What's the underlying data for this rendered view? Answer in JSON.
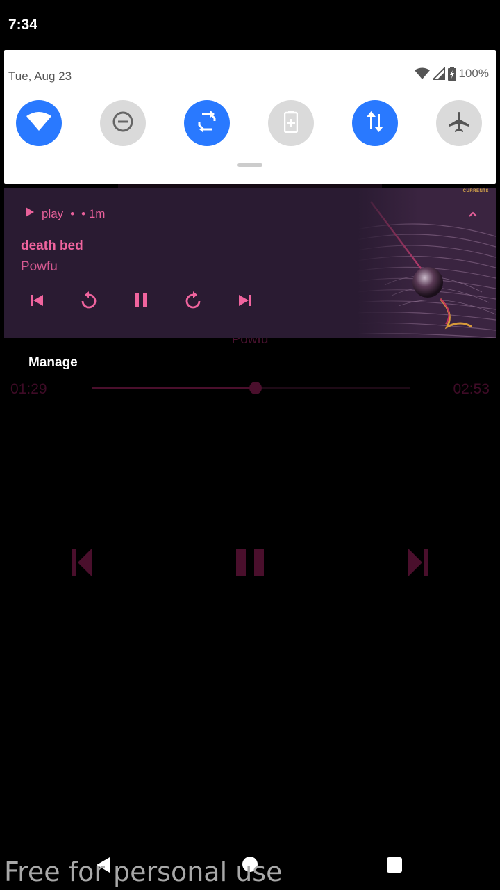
{
  "status_bar": {
    "time": "7:34"
  },
  "background_player": {
    "artist": "Powfu",
    "elapsed": "01:29",
    "duration": "02:53",
    "progress": 0.515
  },
  "quick_settings": {
    "date": "Tue, Aug 23",
    "battery": "100%",
    "tiles": [
      {
        "name": "wifi",
        "state": "on",
        "icon": "wifi-icon"
      },
      {
        "name": "do-not-disturb",
        "state": "off",
        "icon": "minus-circle-icon"
      },
      {
        "name": "auto-rotate",
        "state": "on",
        "icon": "rotate-icon"
      },
      {
        "name": "battery-saver",
        "state": "off",
        "icon": "battery-icon"
      },
      {
        "name": "mobile-data",
        "state": "on",
        "icon": "data-arrows-icon"
      },
      {
        "name": "airplane-mode",
        "state": "off",
        "icon": "airplane-icon"
      }
    ]
  },
  "media_notification": {
    "app_name": "play",
    "separator": "•",
    "time_ago": "• 1m",
    "title": "death bed",
    "artist": "Powfu",
    "album_label": "CURRENTS",
    "controls": [
      "skip-previous-icon",
      "replay-icon",
      "pause-icon",
      "forward-icon",
      "skip-next-icon"
    ]
  },
  "manage_label": "Manage",
  "watermark": "Free for personal use",
  "colors": {
    "accent": "#f0649e",
    "tile_on": "#2979ff",
    "tile_off": "#dadada",
    "card_bg": "#2a1b32"
  }
}
